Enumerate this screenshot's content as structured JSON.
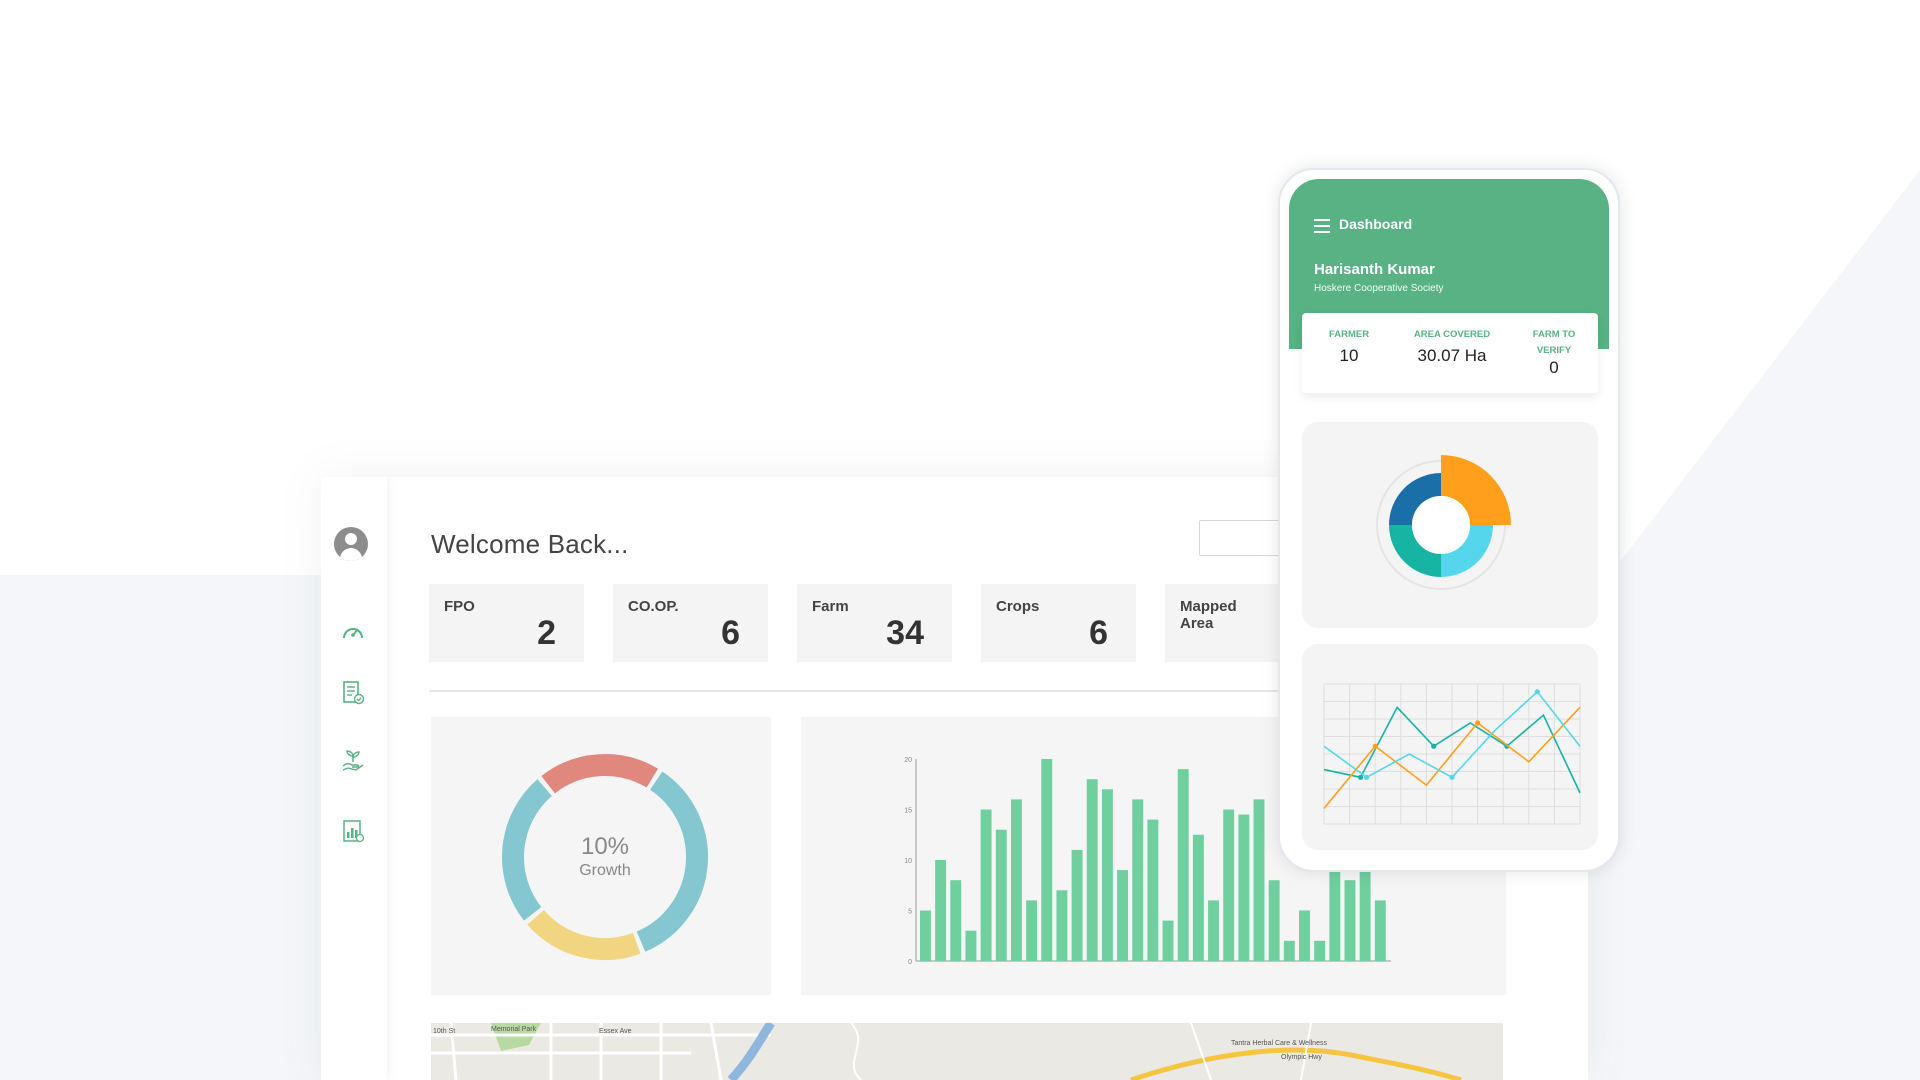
{
  "desktop": {
    "welcome": "Welcome Back...",
    "stats": [
      {
        "label": "FPO",
        "value": "2"
      },
      {
        "label": "CO.OP.",
        "value": "6"
      },
      {
        "label": "Farm",
        "value": "34"
      },
      {
        "label": "Crops",
        "value": "6"
      },
      {
        "label": "Mapped Area",
        "value": ""
      }
    ],
    "donut": {
      "center_value": "10%",
      "center_label": "Growth",
      "segments": [
        {
          "color": "#e0877e",
          "share": 0.2
        },
        {
          "color": "#84c7d0",
          "share": 0.35
        },
        {
          "color": "#f2d580",
          "share": 0.2
        },
        {
          "color": "#84c7d0",
          "share": 0.25
        }
      ]
    },
    "bar_chart": {
      "ytick_labels": [
        "0",
        "5",
        "10",
        "15",
        "20"
      ],
      "bar_color": "#6fcf9f"
    },
    "map_labels": [
      "10th St",
      "Memorial Park",
      "Essex Ave",
      "Tantra Herbal Care & Wellness",
      "Olympic Hwy"
    ]
  },
  "phone": {
    "title": "Dashboard",
    "user_name": "Harisanth Kumar",
    "organization": "Hoskere Cooperative Society",
    "stats": [
      {
        "label_line1": "FARMER",
        "label_line2": "",
        "value": "10"
      },
      {
        "label_line1": "AREA COVERED",
        "label_line2": "",
        "value": "30.07 Ha"
      },
      {
        "label_line1": "FARM TO",
        "label_line2": "VERIFY",
        "value": "0"
      }
    ],
    "header_color": "#58b283"
  },
  "chart_data": [
    {
      "type": "pie",
      "title": "",
      "center_text": "10% Growth",
      "values": [
        20,
        35,
        20,
        25
      ],
      "colors": [
        "#e0877e",
        "#84c7d0",
        "#f2d580",
        "#84c7d0"
      ]
    },
    {
      "type": "bar",
      "title": "",
      "xlabel": "",
      "ylabel": "",
      "ylim": [
        0,
        20
      ],
      "yticks": [
        0,
        5,
        10,
        15,
        20
      ],
      "values": [
        5,
        10,
        8,
        3,
        15,
        13,
        16,
        6,
        20,
        7,
        11,
        18,
        17,
        9,
        16,
        14,
        4,
        19,
        12.5,
        6,
        15,
        14.5,
        16,
        8,
        2,
        5,
        2,
        9,
        8,
        9,
        6
      ]
    },
    {
      "type": "pie",
      "title": "",
      "values": [
        25,
        25,
        25,
        25
      ],
      "colors": [
        "#ff9f1c",
        "#55d6ec",
        "#17b3a3",
        "#1b6fa8"
      ]
    },
    {
      "type": "line",
      "title": "",
      "series": [
        {
          "color": "#17b3a3",
          "values": [
            3.5,
            3,
            7.5,
            5,
            6.5,
            5,
            7,
            2
          ]
        },
        {
          "color": "#ff9f1c",
          "values": [
            1,
            5,
            2.5,
            6.5,
            4,
            7.5
          ]
        },
        {
          "color": "#55d6ec",
          "values": [
            5,
            3,
            4.5,
            3,
            6,
            8.5,
            5
          ]
        }
      ]
    }
  ]
}
